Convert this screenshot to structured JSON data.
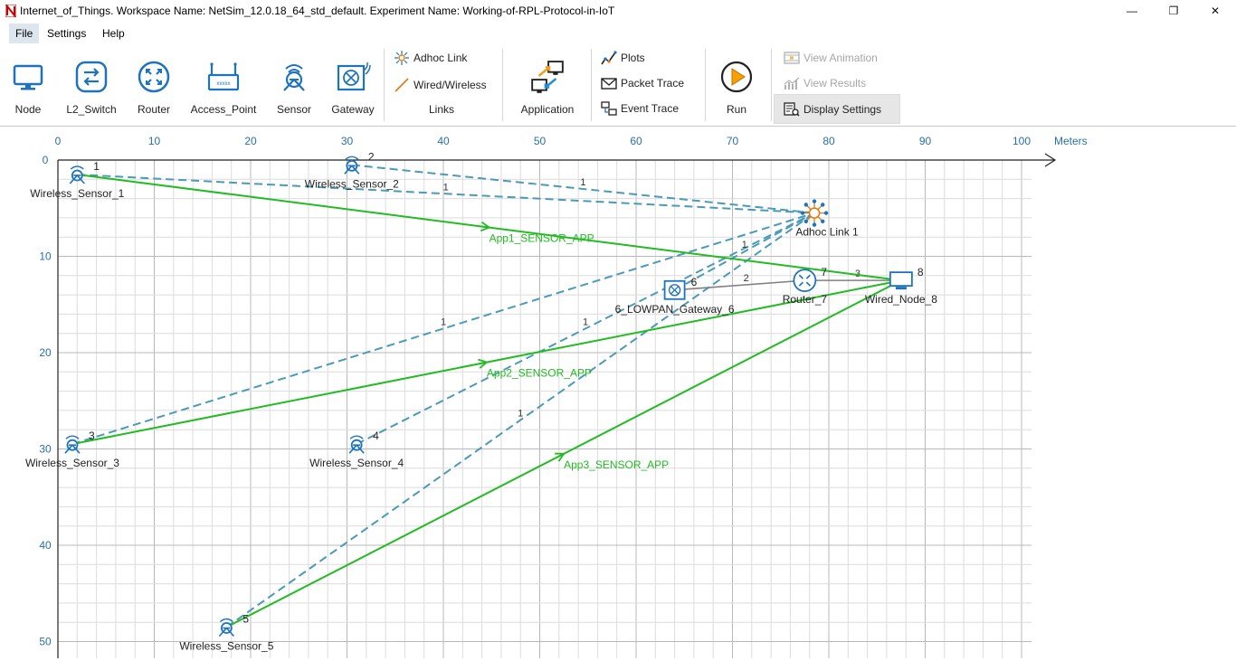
{
  "window": {
    "title": "Internet_of_Things. Workspace Name: NetSim_12.0.18_64_std_default. Experiment Name: Working-of-RPL-Protocol-in-IoT",
    "minimize_glyph": "—",
    "restore_glyph": "❐",
    "close_glyph": "✕"
  },
  "menu": {
    "items": [
      "File",
      "Settings",
      "Help"
    ],
    "active": "File"
  },
  "ribbon": {
    "devices": [
      {
        "label": "Node",
        "icon": "node-icon"
      },
      {
        "label": "L2_Switch",
        "icon": "switch-icon"
      },
      {
        "label": "Router",
        "icon": "router-icon"
      },
      {
        "label": "Access_Point",
        "icon": "access-point-icon"
      },
      {
        "label": "Sensor",
        "icon": "sensor-icon"
      },
      {
        "label": "Gateway",
        "icon": "gateway-icon"
      }
    ],
    "links": {
      "adhoc": "Adhoc Link",
      "wired": "Wired/Wireless",
      "group": "Links"
    },
    "application": "Application",
    "outputs": {
      "plots": "Plots",
      "packet_trace": "Packet Trace",
      "event_trace": "Event Trace"
    },
    "run": "Run",
    "view": {
      "animation": "View Animation",
      "results": "View Results",
      "display_settings": "Display Settings"
    }
  },
  "grid": {
    "unit_label": "Meters",
    "x_ticks": [
      "0",
      "10",
      "20",
      "30",
      "40",
      "50",
      "60",
      "70",
      "80",
      "90",
      "100"
    ],
    "y_ticks": [
      "0",
      "10",
      "20",
      "30",
      "40",
      "50"
    ]
  },
  "devices": [
    {
      "id": "1",
      "name": "Wireless_Sensor_1",
      "type": "sensor",
      "x": 2,
      "y": 1.5
    },
    {
      "id": "2",
      "name": "Wireless_Sensor_2",
      "type": "sensor",
      "x": 30.5,
      "y": 0.5
    },
    {
      "id": "3",
      "name": "Wireless_Sensor_3",
      "type": "sensor",
      "x": 1.5,
      "y": 29.5
    },
    {
      "id": "4",
      "name": "Wireless_Sensor_4",
      "type": "sensor",
      "x": 31,
      "y": 29.5
    },
    {
      "id": "5",
      "name": "Wireless_Sensor_5",
      "type": "sensor",
      "x": 17.5,
      "y": 48.5
    },
    {
      "id": "6",
      "name": "6_LOWPAN_Gateway_6",
      "type": "gateway",
      "x": 64,
      "y": 13.5
    },
    {
      "id": "7",
      "name": "Router_7",
      "type": "router",
      "x": 77.5,
      "y": 12.5
    },
    {
      "id": "8",
      "name": "Wired_Node_8",
      "type": "node",
      "x": 87.5,
      "y": 12.5
    },
    {
      "id": "",
      "name": "Adhoc Link 1",
      "type": "adhoc",
      "x": 78.5,
      "y": 5.5
    }
  ],
  "links": [
    {
      "from": "Wireless_Sensor_1",
      "to": "Adhoc Link 1",
      "kind": "wireless",
      "label": "1"
    },
    {
      "from": "Wireless_Sensor_2",
      "to": "Adhoc Link 1",
      "kind": "wireless",
      "label": "1"
    },
    {
      "from": "Wireless_Sensor_3",
      "to": "Adhoc Link 1",
      "kind": "wireless",
      "label": "1"
    },
    {
      "from": "Wireless_Sensor_4",
      "to": "Adhoc Link 1",
      "kind": "wireless",
      "label": "1"
    },
    {
      "from": "Wireless_Sensor_5",
      "to": "Adhoc Link 1",
      "kind": "wireless",
      "label": "1"
    },
    {
      "from": "6_LOWPAN_Gateway_6",
      "to": "Adhoc Link 1",
      "kind": "wireless",
      "label": "1"
    },
    {
      "from": "6_LOWPAN_Gateway_6",
      "to": "Router_7",
      "kind": "wired",
      "label": "2"
    },
    {
      "from": "Router_7",
      "to": "Wired_Node_8",
      "kind": "wired",
      "label": "3"
    }
  ],
  "applications": [
    {
      "name": "App1_SENSOR_APP",
      "from": "Wireless_Sensor_1",
      "to": "Wired_Node_8"
    },
    {
      "name": "App2_SENSOR_APP",
      "from": "Wireless_Sensor_3",
      "to": "Wired_Node_8"
    },
    {
      "name": "App3_SENSOR_APP",
      "from": "Wireless_Sensor_5",
      "to": "Wired_Node_8"
    }
  ],
  "colors": {
    "wireless": "#4a9ab8",
    "app": "#22bb22",
    "wired": "#808080",
    "axis": "#2a6fa8",
    "accent": "#1e73be"
  }
}
